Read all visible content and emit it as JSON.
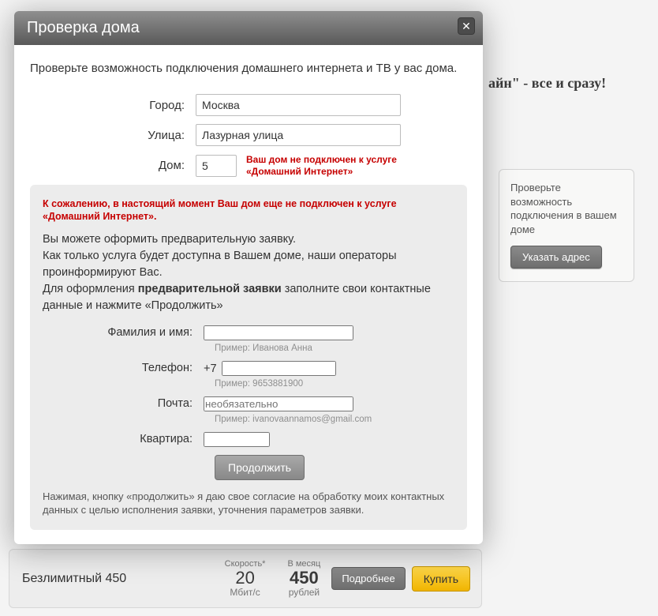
{
  "bg": {
    "headline_fragment": "айн\" - все и сразу!"
  },
  "side": {
    "text": "Проверьте возможность подключения\nв вашем доме",
    "button": "Указать адрес"
  },
  "tariff": {
    "name": "Безлимитный 450",
    "speed_label": "Скорость*",
    "speed_value": "20",
    "speed_unit": "Мбит/с",
    "price_label": "В месяц",
    "price_value": "450",
    "price_unit": "рублей",
    "more": "Подробнее",
    "buy": "Купить"
  },
  "modal": {
    "title": "Проверка дома",
    "intro": "Проверьте возможность подключения домашнего интернета и ТВ у вас дома.",
    "labels": {
      "city": "Город:",
      "street": "Улица:",
      "house": "Дом:"
    },
    "values": {
      "city": "Москва",
      "street": "Лазурная улица",
      "house": "5"
    },
    "house_error": "Ваш дом не подключен к услуге «Домашний Интернет»",
    "panel": {
      "error": "К сожалению, в настоящий момент Ваш дом еще не подключен к услуге «Домашний Интернет».",
      "desc_1": "Вы можете оформить предварительную заявку.",
      "desc_2": "Как только услуга будет доступна в Вашем доме, наши операторы проинформируют Вас.",
      "desc_3a": "Для оформления ",
      "desc_3b": "предварительной заявки",
      "desc_3c": " заполните свои контактные данные и нажмите «Продолжить»",
      "labels": {
        "name": "Фамилия и имя:",
        "phone": "Телефон:",
        "phone_prefix": "+7",
        "email": "Почта:",
        "flat": "Квартира:"
      },
      "placeholders": {
        "email": "необязательно"
      },
      "hints": {
        "name": "Пример: Иванова Анна",
        "phone": "Пример: 9653881900",
        "email": "Пример: ivanovaannamos@gmail.com"
      },
      "continue": "Продолжить",
      "consent": "Нажимая, кнопку «продолжить» я даю свое согласие на обработку моих контактных данных с целью исполнения заявки, уточнения параметров заявки."
    }
  }
}
